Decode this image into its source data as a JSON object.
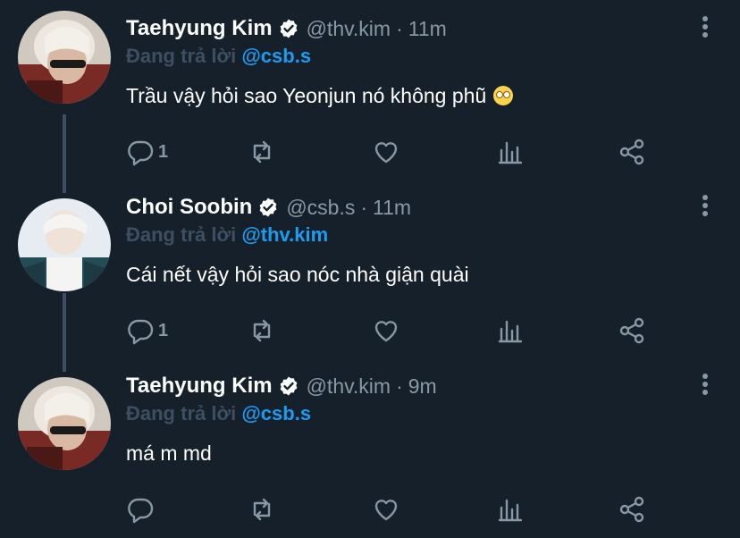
{
  "tweets": [
    {
      "name": "Taehyung Kim",
      "handle": "@thv.kim",
      "time": "11m",
      "replying_prefix": "Đang trả lời",
      "replying_to": "@csb.s",
      "text": "Trầu vậy hỏi sao Yeonjun nó không phũ",
      "emoji": "face-with-rolling-eyes",
      "reply_count": "1",
      "avatar_colors": [
        "#e8e4dc",
        "#8c2f2a"
      ]
    },
    {
      "name": "Choi Soobin",
      "handle": "@csb.s",
      "time": "11m",
      "replying_prefix": "Đang trả lời",
      "replying_to": "@thv.kim",
      "text": "Cái nết vậy hỏi sao nóc nhà giận quài",
      "reply_count": "1",
      "avatar_colors": [
        "#e9eef3",
        "#1f4d57"
      ]
    },
    {
      "name": "Taehyung Kim",
      "handle": "@thv.kim",
      "time": "9m",
      "replying_prefix": "Đang trả lời",
      "replying_to": "@csb.s",
      "text": "má m md",
      "reply_count": "",
      "avatar_colors": [
        "#e8e4dc",
        "#8c2f2a"
      ]
    }
  ],
  "colors": {
    "background": "#15202b",
    "secondary_text": "#8899a6",
    "link": "#1d9bf0",
    "thread_line": "#3d4f61"
  },
  "icons": {
    "verified": "verified-badge-icon",
    "more": "more-vertical-icon",
    "reply": "reply-icon",
    "retweet": "retweet-icon",
    "like": "heart-icon",
    "analytics": "analytics-icon",
    "share": "share-icon"
  }
}
